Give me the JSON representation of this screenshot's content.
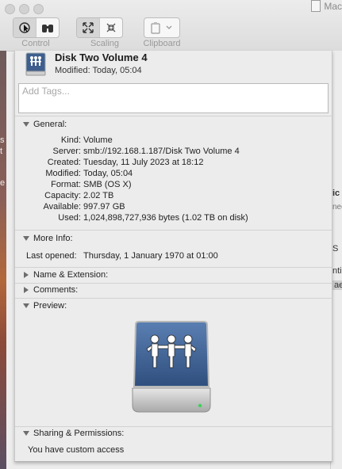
{
  "background_window": {
    "title_partial": "Mac",
    "toolbar_groups": [
      {
        "label": "Control"
      },
      {
        "label": "Scaling"
      },
      {
        "label": "Clipboard"
      }
    ],
    "left_strip_letters": [
      "s",
      "t",
      "",
      "e"
    ],
    "right_strip_texts": [
      "ic",
      "ned",
      "S",
      "nti",
      "ae"
    ]
  },
  "info": {
    "title": "Disk Two Volume 4",
    "modified_header": "Modified: Today, 05:04",
    "tags_placeholder": "Add Tags...",
    "sections": {
      "general": "General:",
      "more_info": "More Info:",
      "name_extension": "Name & Extension:",
      "comments": "Comments:",
      "preview": "Preview:",
      "sharing": "Sharing & Permissions:"
    },
    "general_rows": [
      {
        "key": "Kind:",
        "value": "Volume"
      },
      {
        "key": "Server:",
        "value": "smb://192.168.1.187/Disk Two Volume 4"
      },
      {
        "key": "Created:",
        "value": "Tuesday, 11 July 2023 at 18:12"
      },
      {
        "key": "Modified:",
        "value": "Today, 05:04"
      },
      {
        "key": "Format:",
        "value": "SMB (OS X)"
      },
      {
        "key": "Capacity:",
        "value": "2.02 TB"
      },
      {
        "key": "Available:",
        "value": "997.97 GB"
      },
      {
        "key": "Used:",
        "value": "1,024,898,727,936 bytes (1.02 TB on disk)"
      }
    ],
    "last_opened_label": "Last opened:",
    "last_opened_value": "Thursday, 1 January 1970 at 01:00",
    "sharing_text": "You have custom access"
  },
  "colors": {
    "panel_bg": "#ececec",
    "drive_icon_blue": "#3e5f8d"
  }
}
